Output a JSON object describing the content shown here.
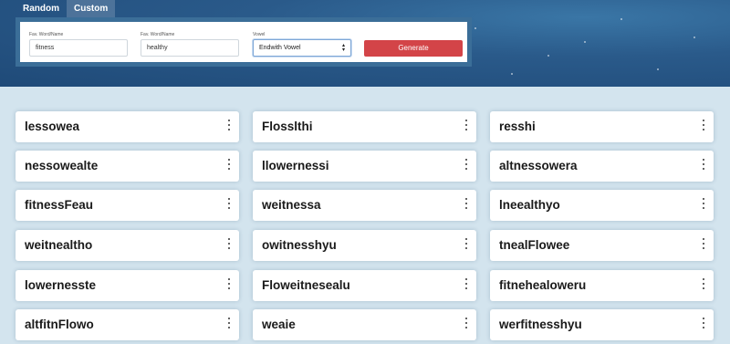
{
  "tabs": [
    {
      "label": "Random",
      "active": false
    },
    {
      "label": "Custom",
      "active": true
    }
  ],
  "form": {
    "field1": {
      "label": "Fav. Word/Name",
      "value": "fitness"
    },
    "field2": {
      "label": "Fav. Word/Name",
      "value": "healthy"
    },
    "vowel": {
      "label": "Vowel",
      "selected": "Endwith Vowel"
    },
    "generate_label": "Generate"
  },
  "results": [
    [
      "lessowea",
      "Flosslthi",
      "resshi"
    ],
    [
      "nessowealte",
      "llowernessi",
      "altnessowera"
    ],
    [
      "fitnessFeau",
      "weitnessa",
      "lneealthyo"
    ],
    [
      "weitnealtho",
      "owitnesshyu",
      "tnealFlowee"
    ],
    [
      "lowernesste",
      "Floweitnesealu",
      "fitnehealoweru"
    ],
    [
      "altfitnFlowo",
      "weaie",
      "werfitnesshyu"
    ]
  ],
  "colors": {
    "accent": "#d34448",
    "hero": "#2a5a8a",
    "background": "#d3e4ee"
  }
}
